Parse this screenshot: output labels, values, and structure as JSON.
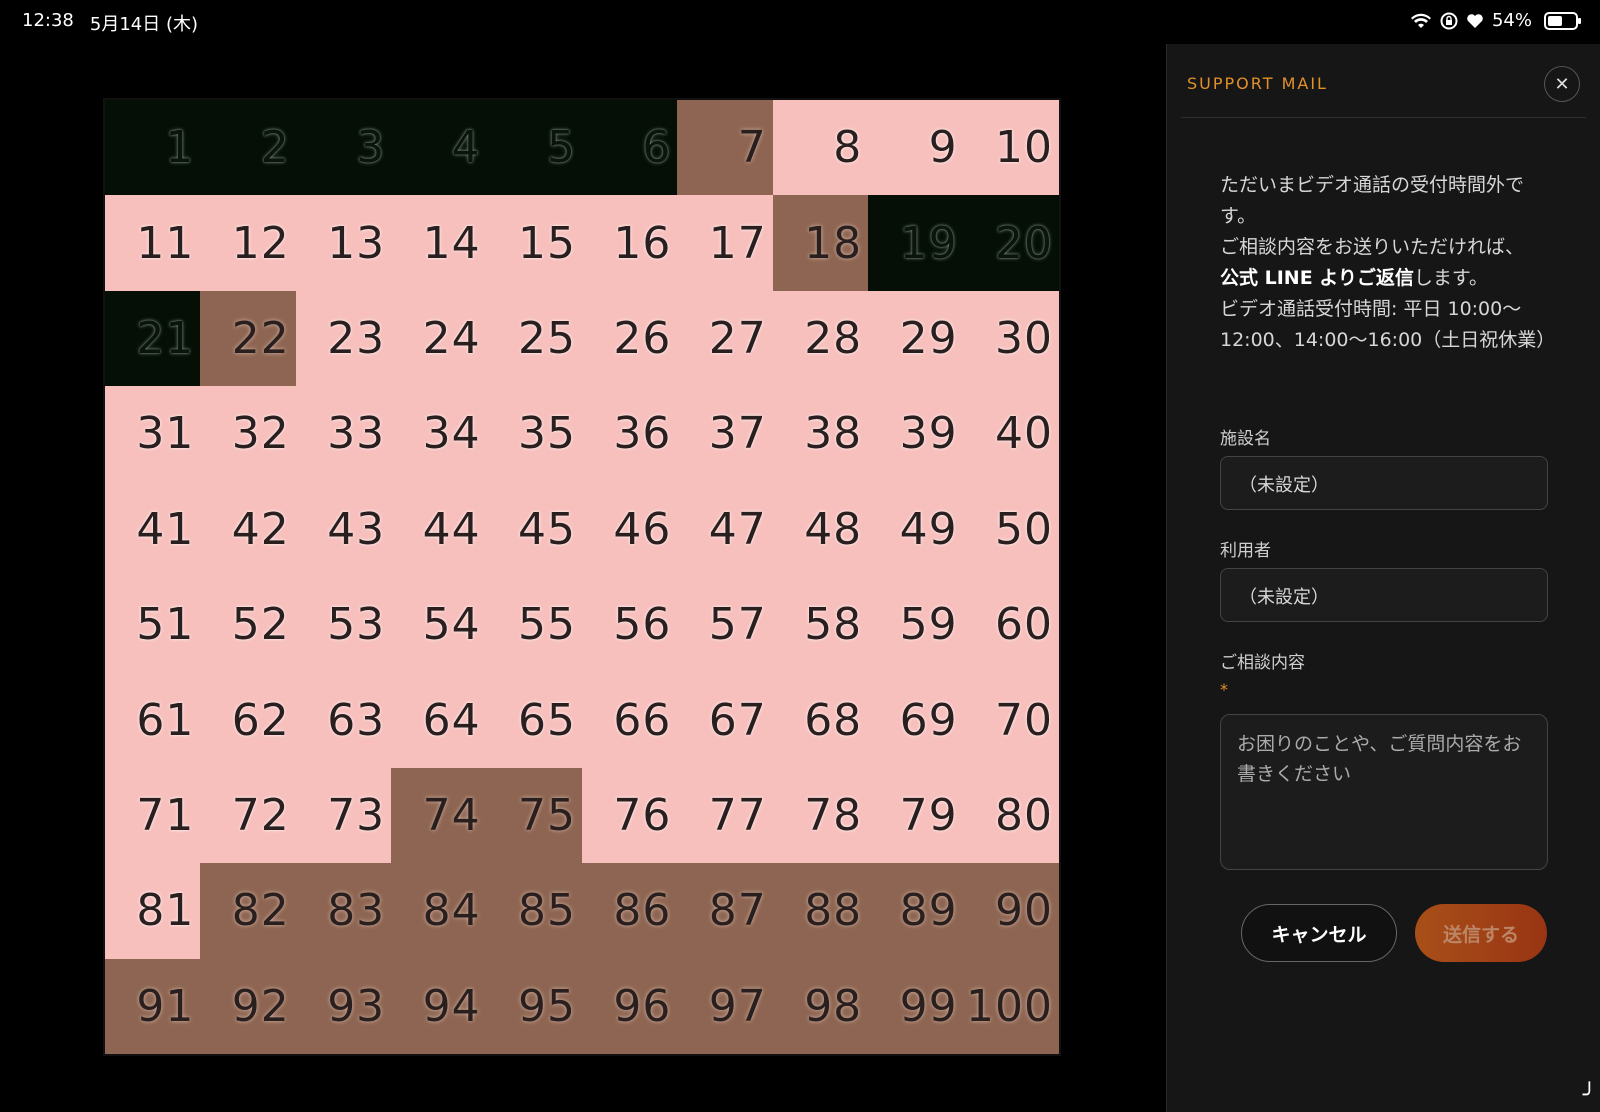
{
  "status_bar": {
    "time": "12:38",
    "date": "5月14日 (木)",
    "battery_percent": "54%",
    "battery_level": 0.54,
    "icons": [
      "wifi-icon",
      "rotation-lock-icon",
      "heart-icon",
      "battery-icon"
    ]
  },
  "grid": {
    "cells": [
      {
        "n": "1",
        "c": "dark"
      },
      {
        "n": "2",
        "c": "dark"
      },
      {
        "n": "3",
        "c": "dark"
      },
      {
        "n": "4",
        "c": "dark"
      },
      {
        "n": "5",
        "c": "dark"
      },
      {
        "n": "6",
        "c": "dark"
      },
      {
        "n": "7",
        "c": "brown"
      },
      {
        "n": "8",
        "c": "pink"
      },
      {
        "n": "9",
        "c": "pink"
      },
      {
        "n": "10",
        "c": "pink"
      },
      {
        "n": "11",
        "c": "pink"
      },
      {
        "n": "12",
        "c": "pink"
      },
      {
        "n": "13",
        "c": "pink"
      },
      {
        "n": "14",
        "c": "pink"
      },
      {
        "n": "15",
        "c": "pink"
      },
      {
        "n": "16",
        "c": "pink"
      },
      {
        "n": "17",
        "c": "pink"
      },
      {
        "n": "18",
        "c": "brown"
      },
      {
        "n": "19",
        "c": "dark"
      },
      {
        "n": "20",
        "c": "dark"
      },
      {
        "n": "21",
        "c": "dark"
      },
      {
        "n": "22",
        "c": "brown"
      },
      {
        "n": "23",
        "c": "pink"
      },
      {
        "n": "24",
        "c": "pink"
      },
      {
        "n": "25",
        "c": "pink"
      },
      {
        "n": "26",
        "c": "pink"
      },
      {
        "n": "27",
        "c": "pink"
      },
      {
        "n": "28",
        "c": "pink"
      },
      {
        "n": "29",
        "c": "pink"
      },
      {
        "n": "30",
        "c": "pink"
      },
      {
        "n": "31",
        "c": "pink"
      },
      {
        "n": "32",
        "c": "pink"
      },
      {
        "n": "33",
        "c": "pink"
      },
      {
        "n": "34",
        "c": "pink"
      },
      {
        "n": "35",
        "c": "pink"
      },
      {
        "n": "36",
        "c": "pink"
      },
      {
        "n": "37",
        "c": "pink"
      },
      {
        "n": "38",
        "c": "pink"
      },
      {
        "n": "39",
        "c": "pink"
      },
      {
        "n": "40",
        "c": "pink"
      },
      {
        "n": "41",
        "c": "pink"
      },
      {
        "n": "42",
        "c": "pink"
      },
      {
        "n": "43",
        "c": "pink"
      },
      {
        "n": "44",
        "c": "pink"
      },
      {
        "n": "45",
        "c": "pink"
      },
      {
        "n": "46",
        "c": "pink"
      },
      {
        "n": "47",
        "c": "pink"
      },
      {
        "n": "48",
        "c": "pink"
      },
      {
        "n": "49",
        "c": "pink"
      },
      {
        "n": "50",
        "c": "pink"
      },
      {
        "n": "51",
        "c": "pink"
      },
      {
        "n": "52",
        "c": "pink"
      },
      {
        "n": "53",
        "c": "pink"
      },
      {
        "n": "54",
        "c": "pink"
      },
      {
        "n": "55",
        "c": "pink"
      },
      {
        "n": "56",
        "c": "pink"
      },
      {
        "n": "57",
        "c": "pink"
      },
      {
        "n": "58",
        "c": "pink"
      },
      {
        "n": "59",
        "c": "pink"
      },
      {
        "n": "60",
        "c": "pink"
      },
      {
        "n": "61",
        "c": "pink"
      },
      {
        "n": "62",
        "c": "pink"
      },
      {
        "n": "63",
        "c": "pink"
      },
      {
        "n": "64",
        "c": "pink"
      },
      {
        "n": "65",
        "c": "pink"
      },
      {
        "n": "66",
        "c": "pink"
      },
      {
        "n": "67",
        "c": "pink"
      },
      {
        "n": "68",
        "c": "pink"
      },
      {
        "n": "69",
        "c": "pink"
      },
      {
        "n": "70",
        "c": "pink"
      },
      {
        "n": "71",
        "c": "pink"
      },
      {
        "n": "72",
        "c": "pink"
      },
      {
        "n": "73",
        "c": "pink"
      },
      {
        "n": "74",
        "c": "brown"
      },
      {
        "n": "75",
        "c": "brown"
      },
      {
        "n": "76",
        "c": "pink"
      },
      {
        "n": "77",
        "c": "pink"
      },
      {
        "n": "78",
        "c": "pink"
      },
      {
        "n": "79",
        "c": "pink"
      },
      {
        "n": "80",
        "c": "pink"
      },
      {
        "n": "81",
        "c": "pink"
      },
      {
        "n": "82",
        "c": "brown"
      },
      {
        "n": "83",
        "c": "brown"
      },
      {
        "n": "84",
        "c": "brown"
      },
      {
        "n": "85",
        "c": "brown"
      },
      {
        "n": "86",
        "c": "brown"
      },
      {
        "n": "87",
        "c": "brown"
      },
      {
        "n": "88",
        "c": "brown"
      },
      {
        "n": "89",
        "c": "brown"
      },
      {
        "n": "90",
        "c": "brown"
      },
      {
        "n": "91",
        "c": "brown"
      },
      {
        "n": "92",
        "c": "brown"
      },
      {
        "n": "93",
        "c": "brown"
      },
      {
        "n": "94",
        "c": "brown"
      },
      {
        "n": "95",
        "c": "brown"
      },
      {
        "n": "96",
        "c": "brown"
      },
      {
        "n": "97",
        "c": "brown"
      },
      {
        "n": "98",
        "c": "brown"
      },
      {
        "n": "99",
        "c": "brown"
      },
      {
        "n": "100",
        "c": "brown"
      }
    ],
    "colors": {
      "pink": "#f7c0bd",
      "brown": "#8d6552",
      "dark": "#050f06"
    }
  },
  "panel": {
    "title": "SUPPORT MAIL",
    "close_glyph": "✕",
    "notice_line1": "ただいまビデオ通話の受付時間外です。",
    "notice_line2": "ご相談内容をお送りいただければ、",
    "notice_strong": "公式 LINE よりご返信",
    "notice_after_strong": "します。",
    "notice_line4": "ビデオ通話受付時間: 平日 10:00〜12:00、14:00〜16:00（土日祝休業）",
    "facility_label": "施設名",
    "facility_value": "（未設定）",
    "user_label": "利用者",
    "user_value": "（未設定）",
    "consult_label": "ご相談内容",
    "required_mark": "*",
    "consult_placeholder": "お困りのことや、ご質問内容をお書きください",
    "cancel_label": "キャンセル",
    "send_label": "送信する",
    "accent_color": "#e2902a"
  },
  "corner_glyph": "╯"
}
